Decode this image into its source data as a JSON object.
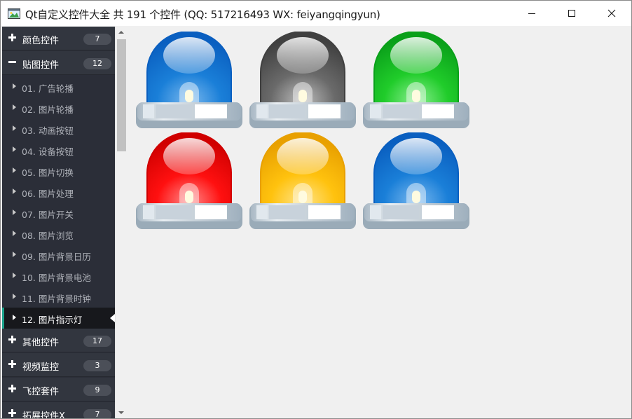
{
  "window": {
    "title": "Qt自定义控件大全 共 191 个控件 (QQ: 517216493 WX: feiyangqingyun)",
    "icons": [
      "app-icon",
      "minimize-icon",
      "maximize-icon",
      "close-icon"
    ]
  },
  "sidebar": {
    "categories": [
      {
        "label": "颜色控件",
        "count": "7",
        "expanded": false
      },
      {
        "label": "贴图控件",
        "count": "12",
        "expanded": true
      },
      {
        "label": "其他控件",
        "count": "17",
        "expanded": false
      },
      {
        "label": "视频监控",
        "count": "3",
        "expanded": false
      },
      {
        "label": "飞控套件",
        "count": "9",
        "expanded": false
      },
      {
        "label": "拓展控件X",
        "count": "7",
        "expanded": false
      }
    ],
    "items": [
      {
        "label": "01. 广告轮播"
      },
      {
        "label": "02. 图片轮播"
      },
      {
        "label": "03. 动画按钮"
      },
      {
        "label": "04. 设备按钮"
      },
      {
        "label": "05. 图片切换"
      },
      {
        "label": "06. 图片处理"
      },
      {
        "label": "07. 图片开关"
      },
      {
        "label": "08. 图片浏览"
      },
      {
        "label": "09. 图片背景日历"
      },
      {
        "label": "10. 图片背景电池"
      },
      {
        "label": "11. 图片背景时钟"
      },
      {
        "label": "12. 图片指示灯"
      }
    ],
    "selected_item": "12. 图片指示灯"
  },
  "content": {
    "lights": [
      {
        "color": "blue",
        "dark": "#0a5fc0",
        "main": "#1a7fd8",
        "light": "#7ab8ee"
      },
      {
        "color": "gray",
        "dark": "#404040",
        "main": "#6a6a6a",
        "light": "#bdbdbd"
      },
      {
        "color": "green",
        "dark": "#0aa01a",
        "main": "#20cc2a",
        "light": "#8aee90"
      },
      {
        "color": "red",
        "dark": "#d00000",
        "main": "#ff1010",
        "light": "#ff8a8a"
      },
      {
        "color": "yellow",
        "dark": "#e8a000",
        "main": "#ffc20e",
        "light": "#ffe48a"
      },
      {
        "color": "blue",
        "dark": "#0a5fc0",
        "main": "#1a7fd8",
        "light": "#7ab8ee"
      }
    ]
  }
}
